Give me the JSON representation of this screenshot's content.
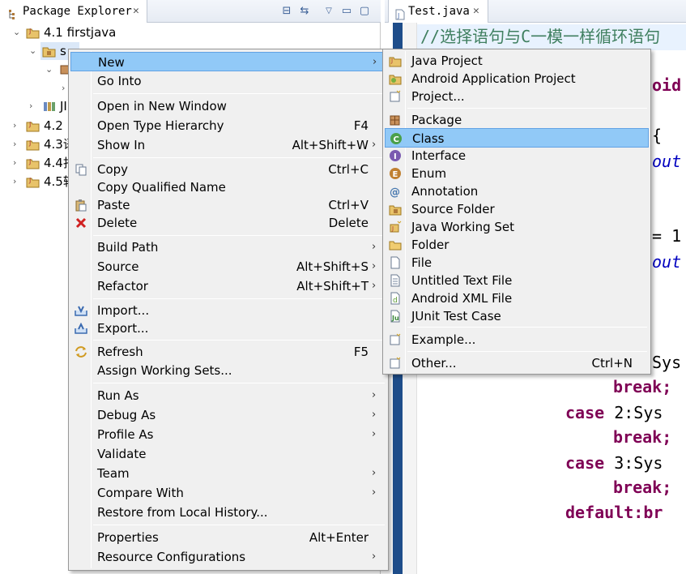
{
  "package_explorer": {
    "tab_title": "Package Explorer",
    "tree": [
      {
        "label": "4.1 firstjava",
        "expanded": true
      },
      {
        "label": "s",
        "expanded": true,
        "selected": true
      },
      {
        "label": "",
        "expanded": true
      },
      {
        "label": ""
      },
      {
        "label": "JI"
      },
      {
        "label": "4.2"
      },
      {
        "label": "4.3语"
      },
      {
        "label": "4.4扫"
      },
      {
        "label": "4.5转"
      }
    ]
  },
  "editor": {
    "tab_title": "Test.java",
    "lines": [
      {
        "text": "//选择语句与C一模一样循环语句"
      },
      {
        "text": "oid"
      },
      {
        "text": "{"
      },
      {
        "text": "out"
      },
      {
        "text": "= 1"
      },
      {
        "text": "out"
      },
      {
        "text": "Sys"
      },
      {
        "text": "break;"
      },
      {
        "kw": "case",
        "rest": " 2:Sys"
      },
      {
        "text": "break;"
      },
      {
        "kw": "case",
        "rest": " 3:Sys"
      },
      {
        "text": "break;"
      },
      {
        "kw": "default:",
        "rest": "br"
      }
    ]
  },
  "context_menu": {
    "items": [
      {
        "label": "New",
        "accel": "",
        "submenu": true,
        "icon": ""
      },
      {
        "label": "Go Into",
        "accel": "",
        "icon": ""
      },
      {
        "label": "Open in New Window",
        "accel": "",
        "icon": ""
      },
      {
        "label": "Open Type Hierarchy",
        "accel": "F4",
        "icon": ""
      },
      {
        "label": "Show In",
        "accel": "Alt+Shift+W",
        "submenu": true,
        "icon": ""
      },
      {
        "label": "Copy",
        "accel": "Ctrl+C",
        "icon": "copy-icon"
      },
      {
        "label": "Copy Qualified Name",
        "accel": "",
        "icon": ""
      },
      {
        "label": "Paste",
        "accel": "Ctrl+V",
        "icon": "paste-icon"
      },
      {
        "label": "Delete",
        "accel": "Delete",
        "icon": "delete-icon"
      },
      {
        "label": "Build Path",
        "accel": "",
        "submenu": true,
        "icon": ""
      },
      {
        "label": "Source",
        "accel": "Alt+Shift+S",
        "submenu": true,
        "icon": ""
      },
      {
        "label": "Refactor",
        "accel": "Alt+Shift+T",
        "submenu": true,
        "icon": ""
      },
      {
        "label": "Import...",
        "accel": "",
        "icon": "import-icon"
      },
      {
        "label": "Export...",
        "accel": "",
        "icon": "export-icon"
      },
      {
        "label": "Refresh",
        "accel": "F5",
        "icon": "refresh-icon"
      },
      {
        "label": "Assign Working Sets...",
        "accel": "",
        "icon": ""
      },
      {
        "label": "Run As",
        "accel": "",
        "submenu": true,
        "icon": ""
      },
      {
        "label": "Debug As",
        "accel": "",
        "submenu": true,
        "icon": ""
      },
      {
        "label": "Profile As",
        "accel": "",
        "submenu": true,
        "icon": ""
      },
      {
        "label": "Validate",
        "accel": "",
        "icon": ""
      },
      {
        "label": "Team",
        "accel": "",
        "submenu": true,
        "icon": ""
      },
      {
        "label": "Compare With",
        "accel": "",
        "submenu": true,
        "icon": ""
      },
      {
        "label": "Restore from Local History...",
        "accel": "",
        "icon": ""
      },
      {
        "label": "Properties",
        "accel": "Alt+Enter",
        "icon": ""
      },
      {
        "label": "Resource Configurations",
        "accel": "",
        "submenu": true,
        "icon": ""
      }
    ]
  },
  "new_submenu": {
    "items": [
      {
        "label": "Java Project",
        "icon": "java-project-icon"
      },
      {
        "label": "Android Application Project",
        "icon": "android-project-icon"
      },
      {
        "label": "Project...",
        "icon": "project-icon"
      },
      {
        "label": "Package",
        "icon": "package-icon"
      },
      {
        "label": "Class",
        "icon": "class-icon",
        "highlighted": true
      },
      {
        "label": "Interface",
        "icon": "interface-icon"
      },
      {
        "label": "Enum",
        "icon": "enum-icon"
      },
      {
        "label": "Annotation",
        "icon": "annotation-icon"
      },
      {
        "label": "Source Folder",
        "icon": "source-folder-icon"
      },
      {
        "label": "Java Working Set",
        "icon": "working-set-icon"
      },
      {
        "label": "Folder",
        "icon": "folder-icon"
      },
      {
        "label": "File",
        "icon": "file-icon"
      },
      {
        "label": "Untitled Text File",
        "icon": "text-file-icon"
      },
      {
        "label": "Android XML File",
        "icon": "android-xml-icon"
      },
      {
        "label": "JUnit Test Case",
        "icon": "junit-icon"
      },
      {
        "label": "Example...",
        "icon": "example-icon"
      },
      {
        "label": "Other...",
        "accel": "Ctrl+N",
        "icon": "other-icon"
      }
    ]
  },
  "colors": {
    "menu_highlight": "#91c9f7",
    "keyword": "#7f0055",
    "comment": "#3f7f5f"
  }
}
